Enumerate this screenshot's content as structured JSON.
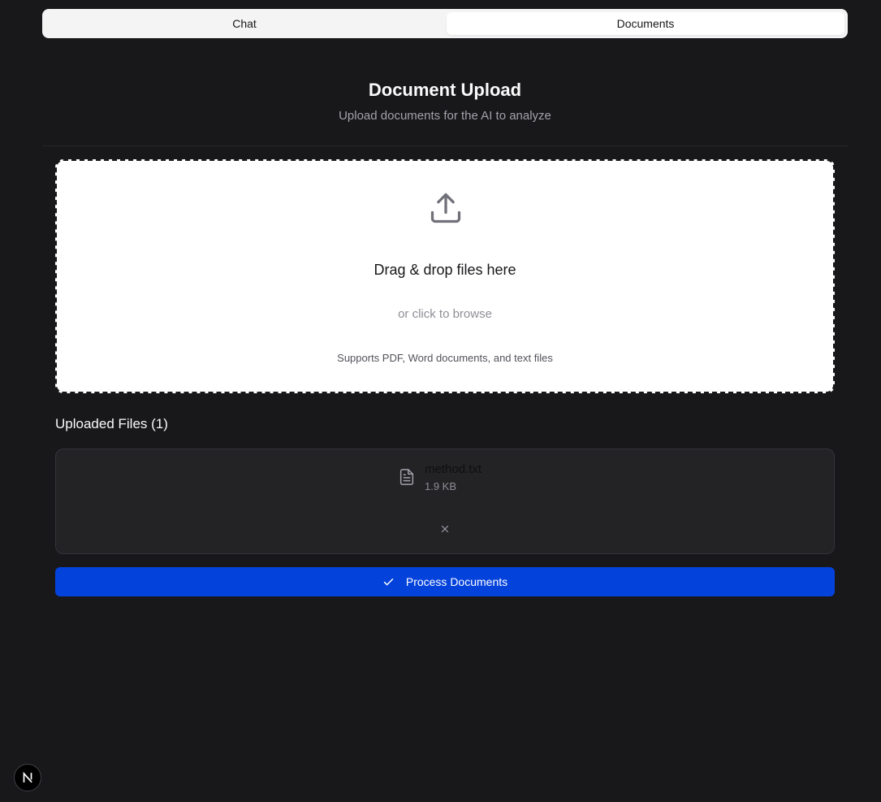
{
  "tabs": [
    {
      "label": "Chat",
      "active": false
    },
    {
      "label": "Documents",
      "active": true
    }
  ],
  "header": {
    "title": "Document Upload",
    "subtitle": "Upload documents for the AI to analyze"
  },
  "dropzone": {
    "icon": "upload-icon",
    "main_text": "Drag & drop files here",
    "sub_text": "or click to browse",
    "note": "Supports PDF, Word documents, and text files"
  },
  "files": {
    "heading": "Uploaded Files",
    "count": "(1)",
    "items": [
      {
        "icon": "file-text-icon",
        "name": "method.txt",
        "size": "1.9 KB"
      }
    ]
  },
  "process_button": {
    "icon": "check-icon",
    "label": "Process Documents"
  },
  "badge": {
    "icon": "nextjs-logo-icon"
  },
  "colors": {
    "background": "#18181b",
    "accent": "#0442dc",
    "card": "#232326"
  }
}
